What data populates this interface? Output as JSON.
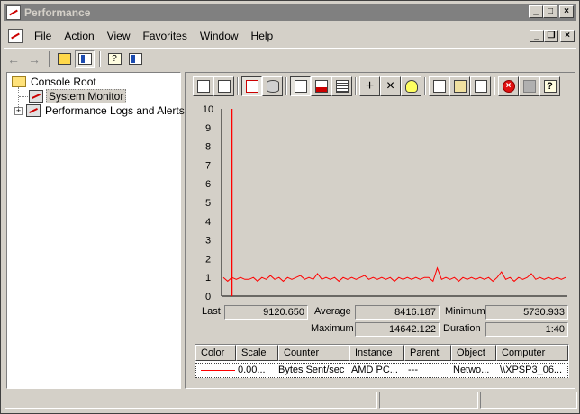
{
  "window": {
    "title": "Performance"
  },
  "menu": {
    "items": [
      "File",
      "Action",
      "View",
      "Favorites",
      "Window",
      "Help"
    ]
  },
  "title_buttons": {
    "minimize": "_",
    "maximize": "□",
    "close": "×"
  },
  "mdi_buttons": {
    "minimize": "_",
    "restore": "❐",
    "close": "×"
  },
  "tree": {
    "root": "Console Root",
    "items": [
      "System Monitor",
      "Performance Logs and Alerts"
    ],
    "expander": "+"
  },
  "toolbar_glyphs": {
    "add": "+",
    "delete": "×",
    "help": "?"
  },
  "nav_glyphs": {
    "back": "←",
    "forward": "→"
  },
  "chart_data": {
    "type": "line",
    "ylim": [
      0,
      10
    ],
    "y_ticks": [
      "10",
      "9",
      "8",
      "7",
      "6",
      "5",
      "4",
      "3",
      "2",
      "1",
      "0"
    ],
    "grid": false,
    "series": [
      {
        "color": "#ff0000",
        "values": [
          1.0,
          0.8,
          1.0,
          0.9,
          1.0,
          0.9,
          0.9,
          1.0,
          0.8,
          1.0,
          0.9,
          1.1,
          0.9,
          1.0,
          0.8,
          1.0,
          0.9,
          1.0,
          1.1,
          0.9,
          1.0,
          0.9,
          1.2,
          0.9,
          1.0,
          0.9,
          1.0,
          0.8,
          1.0,
          0.9,
          1.0,
          0.9,
          1.0,
          1.1,
          0.9,
          1.0,
          0.9,
          1.0,
          0.9,
          1.0,
          0.8,
          1.0,
          0.9,
          1.0,
          0.9,
          1.0,
          0.9,
          1.0,
          1.0,
          0.8,
          1.5,
          0.9,
          1.0,
          0.9,
          1.0,
          0.8,
          1.0,
          0.9,
          1.0,
          0.9,
          1.0,
          0.9,
          1.0,
          0.8,
          1.0,
          1.3,
          0.9,
          1.0,
          0.8,
          1.0,
          0.9,
          1.0,
          1.2,
          0.9,
          1.0,
          0.9,
          1.0,
          0.9,
          1.0,
          0.9,
          1.0
        ]
      }
    ],
    "time_bar_fraction": 0.03
  },
  "stats": {
    "last_label": "Last",
    "last_value": "9120.650",
    "average_label": "Average",
    "average_value": "8416.187",
    "minimum_label": "Minimum",
    "minimum_value": "5730.933",
    "maximum_label": "Maximum",
    "maximum_value": "14642.122",
    "duration_label": "Duration",
    "duration_value": "1:40"
  },
  "legend": {
    "headers": [
      "Color",
      "Scale",
      "Counter",
      "Instance",
      "Parent",
      "Object",
      "Computer"
    ],
    "row": {
      "color": "#ff0000",
      "scale": "0.00...",
      "counter": "Bytes Sent/sec",
      "instance": "AMD PC...",
      "parent": "---",
      "object": "Netwo...",
      "computer": "\\\\XPSP3_06..."
    }
  }
}
